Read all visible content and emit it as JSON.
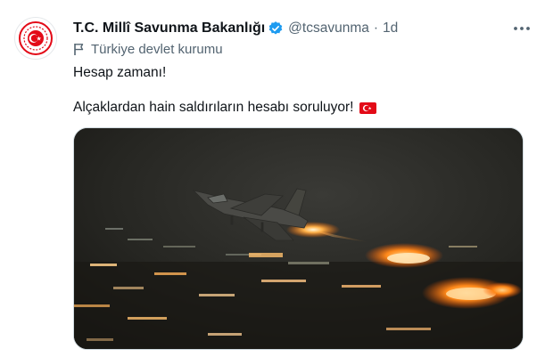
{
  "account": {
    "name": "T.C. Millî Savunma Bakanlığı",
    "handle": "@tcsavunma",
    "separator": "·",
    "time": "1d",
    "label": "Türkiye devlet kurumu"
  },
  "tweet": {
    "line1": "Hesap zamanı!",
    "line2": "Alçaklardan hain saldırıların hesabı soruluyor!"
  },
  "colors": {
    "verified": "#1d9bf0",
    "brand_red": "#e30a17",
    "secondary_text": "#536471"
  },
  "icons": [
    "avatar-crest-icon",
    "verified-badge-icon",
    "more-options-icon",
    "government-flag-icon",
    "turkey-flag-icon"
  ]
}
